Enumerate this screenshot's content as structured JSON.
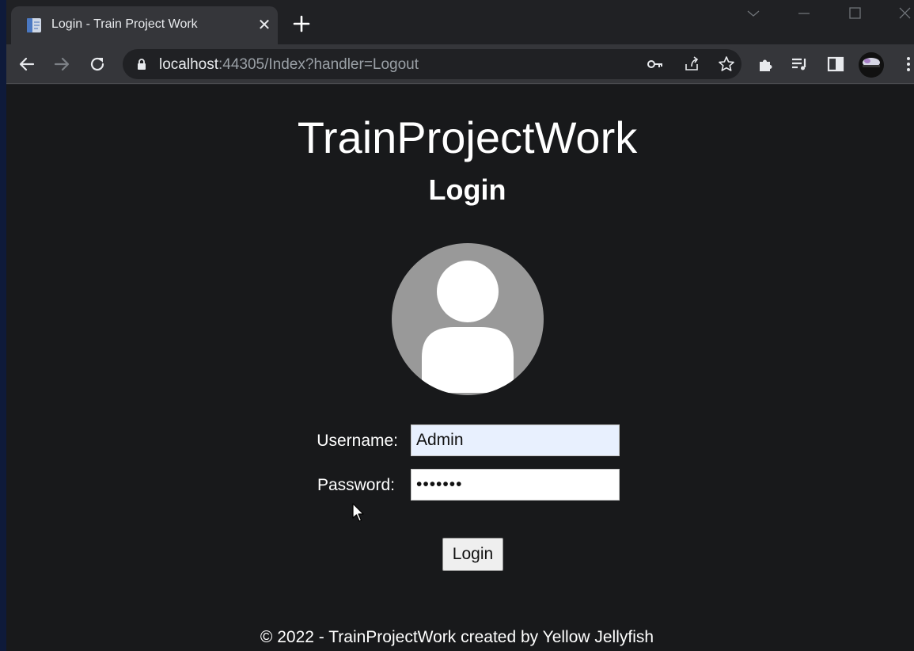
{
  "browser": {
    "tab": {
      "title": "Login - Train Project Work",
      "close_glyph": "✕"
    },
    "omnibox": {
      "url_host": "localhost",
      "url_rest": ":44305/Index?handler=Logout"
    }
  },
  "page": {
    "app_title": "TrainProjectWork",
    "heading": "Login",
    "form": {
      "username_label": "Username:",
      "username_value": "Admin",
      "password_label": "Password:",
      "password_value": "•••••••",
      "submit_label": "Login"
    },
    "footer": "© 2022 - TrainProjectWork created by Yellow Jellyfish"
  },
  "colors": {
    "page_background": "#18191b",
    "autofill_background": "#e8f0fe",
    "avatar_grey": "#999999"
  }
}
